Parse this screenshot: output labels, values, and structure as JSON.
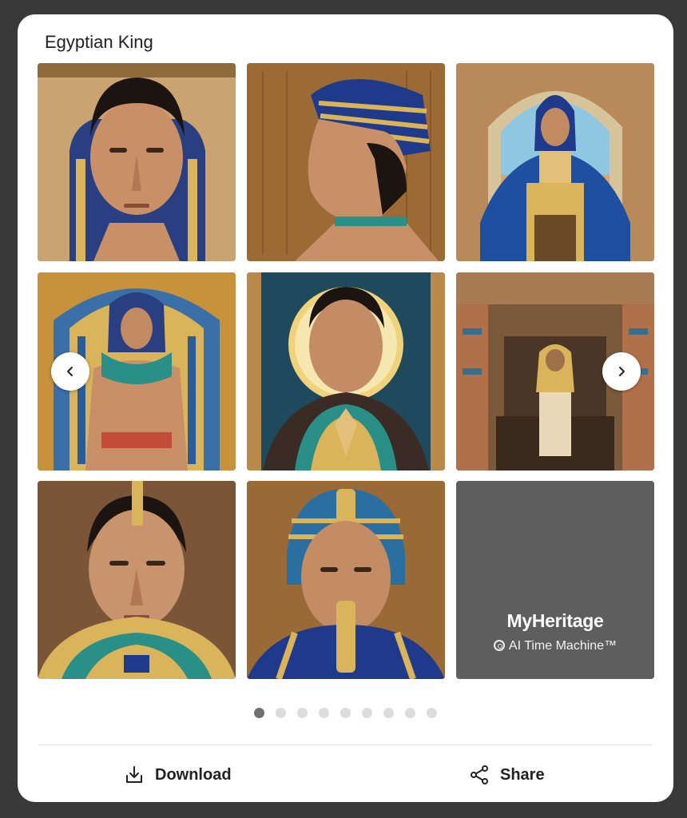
{
  "card": {
    "title": "Egyptian King"
  },
  "gallery": {
    "tiles": [
      {
        "name": "portrait-1"
      },
      {
        "name": "portrait-2"
      },
      {
        "name": "portrait-3"
      },
      {
        "name": "portrait-4"
      },
      {
        "name": "portrait-5"
      },
      {
        "name": "portrait-6"
      },
      {
        "name": "portrait-7"
      },
      {
        "name": "portrait-8"
      }
    ],
    "brand": {
      "name": "MyHeritage",
      "subtitle": "AI Time Machine™"
    },
    "prev_icon": "chevron-left-icon",
    "next_icon": "chevron-right-icon"
  },
  "pagination": {
    "count": 9,
    "active_index": 0
  },
  "actions": {
    "download_label": "Download",
    "download_icon": "download-icon",
    "share_label": "Share",
    "share_icon": "share-icon"
  },
  "colors": {
    "background": "#393939",
    "card": "#ffffff",
    "brand_tile": "#5e5e5e",
    "dot_active": "#6f6f6f",
    "dot_inactive": "#dcdcdc"
  }
}
